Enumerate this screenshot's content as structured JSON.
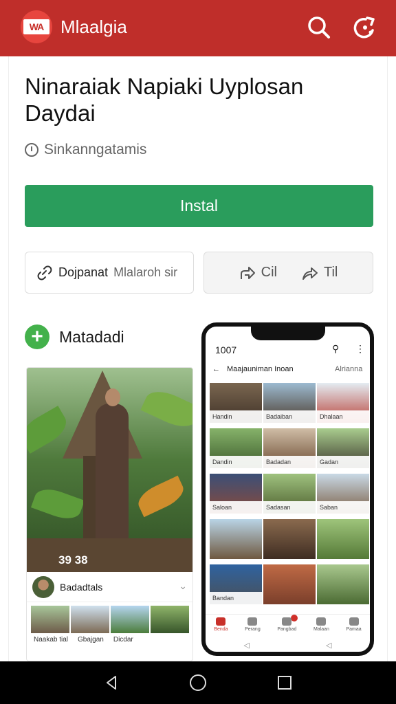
{
  "app": {
    "logo_text": "WA",
    "name": "Mlaalgia"
  },
  "colors": {
    "appbar": "#bf2e2a",
    "install": "#2a9d5c",
    "accent_green": "#43b14b"
  },
  "header_icons": [
    "search-icon",
    "share-icon"
  ],
  "main": {
    "title": "Ninaraiak Napiaki Uyplosan Daydai",
    "meta_text": "Sinkanngatamis",
    "install_label": "Instal",
    "share_button": {
      "bold": "Dojpanat",
      "light": "Mlalaroh sir"
    },
    "actions": [
      {
        "icon": "forward-icon",
        "label": "Cil"
      },
      {
        "icon": "share-arrow-icon",
        "label": "Til"
      }
    ],
    "section_label": "Matadadi"
  },
  "media_card": {
    "overlay": "39 38",
    "row_label": "Badadtals",
    "thumb_labels": [
      "Naakab tial",
      "Gbajgan",
      "Dicdar"
    ]
  },
  "phone": {
    "status": "1007",
    "nav_title": "Maajauniman Inoan",
    "nav_right": "Alrianna",
    "cells": [
      [
        "Handin",
        "Badaiban",
        "Dhalaan"
      ],
      [
        "Dandin",
        "Badadan",
        "Gadan"
      ],
      [
        "Saloan",
        "Sadasan",
        "Saban"
      ],
      [
        "",
        "",
        ""
      ],
      [
        "Bandan",
        "",
        ""
      ]
    ],
    "bottom_tabs": [
      "Benda",
      "Perang",
      "Pangbad",
      "Malaan",
      "Pamaa"
    ]
  },
  "system_nav": [
    "back-icon",
    "home-icon",
    "recent-icon"
  ]
}
